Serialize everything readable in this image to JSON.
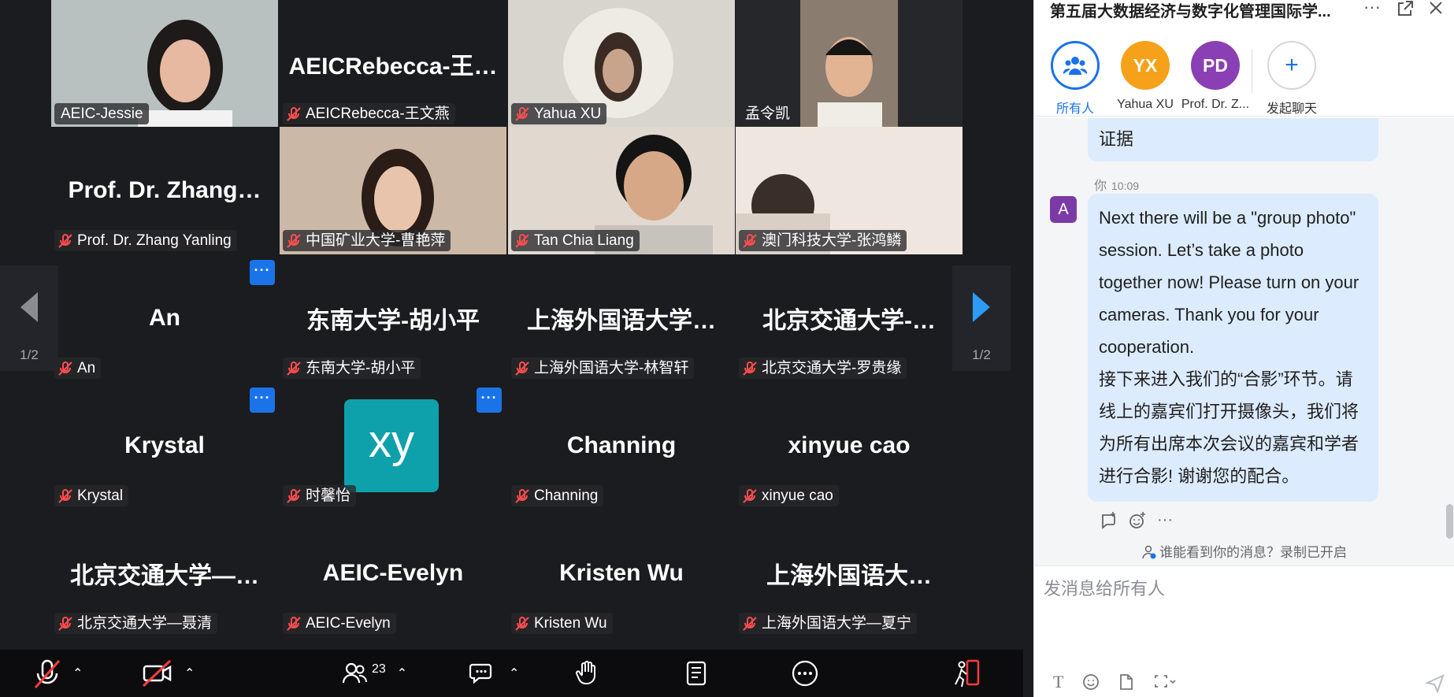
{
  "meeting": {
    "participant_count": "23",
    "page_indicator": "1/2"
  },
  "tiles": [
    {
      "big": "",
      "tag": "AEIC-Jessie",
      "mic_off": false
    },
    {
      "big": "AEICRebecca-王…",
      "tag": "AEICRebecca-王文燕",
      "mic_off": true
    },
    {
      "big": "",
      "tag": "Yahua XU",
      "mic_off": true
    },
    {
      "big": "",
      "tag": "孟令凯",
      "mic_off": false
    },
    {
      "big": "Prof. Dr. Zhang…",
      "tag": "Prof. Dr. Zhang Yanling",
      "mic_off": true
    },
    {
      "big": "",
      "tag": "中国矿业大学-曹艳萍",
      "mic_off": true
    },
    {
      "big": "",
      "tag": "Tan Chia Liang",
      "mic_off": true
    },
    {
      "big": "",
      "tag": "澳门科技大学-张鸿鳞",
      "mic_off": true
    },
    {
      "big": "An",
      "tag": "An",
      "mic_off": true
    },
    {
      "big": "东南大学-胡小平",
      "tag": "东南大学-胡小平",
      "mic_off": true
    },
    {
      "big": "上海外国语大学…",
      "tag": "上海外国语大学-林智轩",
      "mic_off": true
    },
    {
      "big": "北京交通大学-…",
      "tag": "北京交通大学-罗贵缘",
      "mic_off": true
    },
    {
      "big": "Krystal",
      "tag": "Krystal",
      "mic_off": true
    },
    {
      "big": "",
      "tag": "时馨怡",
      "mic_off": true,
      "avatar": "xy"
    },
    {
      "big": "Channing",
      "tag": "Channing",
      "mic_off": true
    },
    {
      "big": "xinyue cao",
      "tag": "xinyue cao",
      "mic_off": true
    },
    {
      "big": "北京交通大学—…",
      "tag": "北京交通大学—聂清",
      "mic_off": true
    },
    {
      "big": "AEIC-Evelyn",
      "tag": "AEIC-Evelyn",
      "mic_off": true
    },
    {
      "big": "Kristen Wu",
      "tag": "Kristen Wu",
      "mic_off": true
    },
    {
      "big": "上海外国语大…",
      "tag": "上海外国语大学—夏宁",
      "mic_off": true
    }
  ],
  "more_button_label": "···",
  "chat": {
    "title": "第五届大数据经济与数字化管理国际学...",
    "recipients": [
      {
        "initials": "",
        "label": "所有人",
        "color": "#1a73e8"
      },
      {
        "initials": "YX",
        "label": "Yahua XU",
        "color": "#f5a11a"
      },
      {
        "initials": "PD",
        "label": "Prof. Dr. Z...",
        "color": "#8a3fb4"
      },
      {
        "initials": "+",
        "label": "发起聊天",
        "color": "#ffffff"
      }
    ],
    "previous_message_tail": "证据",
    "message": {
      "sender": "你",
      "time": "10:09",
      "avatar_initial": "A",
      "lines": [
        "Next there will be a \"group photo\" session. Let’s take a photo together now! Please turn on your cameras. Thank you for your cooperation.",
        "接下来进入我们的“合影”环节。请线上的嘉宾们打开摄像头，我们将为所有出席本次会议的嘉宾和学者进行合影! 谢谢您的配合。"
      ]
    },
    "notice": "谁能看到你的消息？录制已开启",
    "input_placeholder": "发消息给所有人"
  }
}
